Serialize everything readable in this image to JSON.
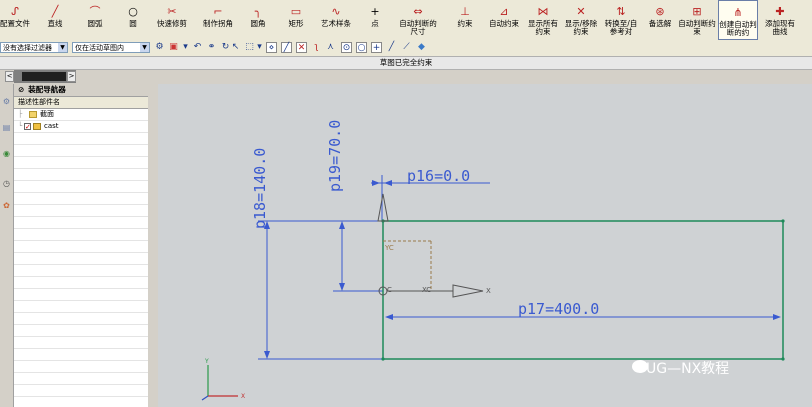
{
  "ribbon": {
    "buttons": [
      {
        "label": "配置文件",
        "icon": "profile-icon"
      },
      {
        "label": "直线",
        "icon": "line-icon"
      },
      {
        "label": "圆弧",
        "icon": "arc-icon"
      },
      {
        "label": "圆",
        "icon": "circle-icon"
      },
      {
        "label": "快速修剪",
        "icon": "trim-icon"
      },
      {
        "label": "制作拐角",
        "icon": "corner-icon"
      },
      {
        "label": "圆角",
        "icon": "fillet-icon"
      },
      {
        "label": "矩形",
        "icon": "rectangle-icon"
      },
      {
        "label": "艺术样条",
        "icon": "spline-icon"
      },
      {
        "label": "点",
        "icon": "point-icon"
      },
      {
        "label": "自动判断的尺寸",
        "icon": "dimension-icon"
      },
      {
        "label": "约束",
        "icon": "constraint-icon"
      },
      {
        "label": "自动约束",
        "icon": "auto-constraint-icon"
      },
      {
        "label": "显示所有约束",
        "icon": "show-constraints-icon"
      },
      {
        "label": "显示/移除约束",
        "icon": "remove-constraints-icon"
      },
      {
        "label": "转换至/自参考对",
        "icon": "convert-reference-icon"
      },
      {
        "label": "备选解",
        "icon": "alternate-solution-icon"
      },
      {
        "label": "自动判断约束",
        "icon": "infer-constraint-icon"
      },
      {
        "label": "创建自动判断的约",
        "icon": "create-inferred-icon"
      },
      {
        "label": "添加现有曲线",
        "icon": "add-curves-icon"
      }
    ]
  },
  "toolbar2": {
    "filter_value": "没有选择过滤器",
    "scope_value": "仅在活动草图内"
  },
  "status": {
    "message": "草图已完全约束"
  },
  "navigator": {
    "title": "装配导航器",
    "column_header": "描述性部件名",
    "items": [
      {
        "label": "截面"
      },
      {
        "label": "cast"
      }
    ]
  },
  "sketch": {
    "dims": {
      "p16": "p16=0.0",
      "p17": "p17=400.0",
      "p18": "p18=140.0",
      "p19": "p19=70.0"
    },
    "axes": {
      "x": "X",
      "y": "Y",
      "xc": "XC",
      "yc": "YC"
    }
  },
  "watermark": {
    "text": "UG—NX教程"
  },
  "colors": {
    "sketch_curve": "#1e8a5a",
    "dimension": "#3a5ad0",
    "viewport_bg": "#cfd2d4"
  }
}
